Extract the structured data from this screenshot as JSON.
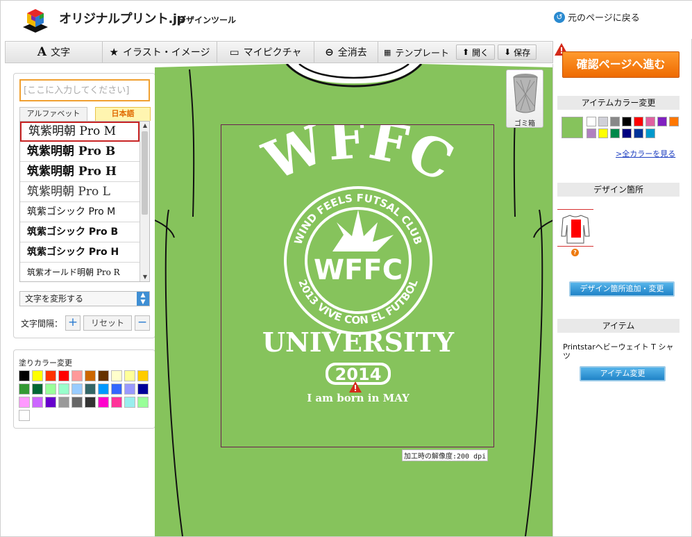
{
  "header": {
    "brand": "オリジナルプリント.jp",
    "subtitle": "デザインツール",
    "back_link": "元のページに戻る",
    "back_icon": "refresh-icon"
  },
  "toolbar": {
    "text": "文字",
    "illust": "イラスト・イメージ",
    "mypicture": "マイピクチャ",
    "clear_all": "全消去",
    "template": "テンプレート",
    "open": "開く",
    "save": "保存"
  },
  "left_panel": {
    "text_placeholder": "[ここに入力してください]",
    "tab_alphabet": "アルファベット",
    "tab_japanese": "日本語",
    "fonts": [
      "筑紫明朝 Pro M",
      "筑紫明朝 Pro B",
      "筑紫明朝 Pro H",
      "筑紫明朝 Pro L",
      "筑紫ゴシック Pro M",
      "筑紫ゴシック Pro B",
      "筑紫ゴシック Pro H",
      "筑紫オールド明朝 Pro R"
    ],
    "selected_font": "筑紫明朝 Pro M",
    "transform": "文字を変形する",
    "spacing_label": "文字間隔：",
    "spacing_reset": "リセット"
  },
  "fill_panel": {
    "title": "塗りカラー変更",
    "colors": [
      "#000000",
      "#ffff00",
      "#ff3300",
      "#ff0000",
      "#ff9999",
      "#cc6600",
      "#663300",
      "#ffffcc",
      "#ffff99",
      "#ffcc00",
      "#339933",
      "#006633",
      "#99ff99",
      "#99ffcc",
      "#99ccff",
      "#336666",
      "#0099ff",
      "#3366ff",
      "#9999ff",
      "#000099",
      "#ff99ff",
      "#cc66ff",
      "#6600cc",
      "#999999",
      "#666666",
      "#333333",
      "#ff00cc",
      "#ff3399",
      "#99eeee",
      "#99ff99",
      "#ffffff"
    ]
  },
  "canvas": {
    "shirt_color": "#86c35c",
    "trash_label": "ゴミ箱",
    "resolution": "加工時の解像度:200 dpi",
    "design": {
      "arc_title": "WFFC",
      "circle_text": "WIND FEELS FUTSAL CLUB",
      "circle_text_bottom": "2013 VIVE CON EL FUTBOL",
      "center": "WFFC",
      "university": "UNIVERSITY",
      "year": "2014",
      "tagline": "I am born in MAY"
    }
  },
  "right_panel": {
    "confirm": "確認ページへ進む",
    "item_color_title": "アイテムカラー変更",
    "item_color_selected": "#86c35c",
    "item_colors": [
      "#ffffff",
      "#d0d0d8",
      "#888888",
      "#000000",
      "#ff0000",
      "#e060a0",
      "#8020c0",
      "#ff7700",
      "#b080c0",
      "#ffff00",
      "#00884a",
      "#000080",
      "#003399",
      "#0099cc"
    ],
    "all_colors_link": ">全カラーを見る",
    "design_location_title": "デザイン箇所",
    "add_location": "デザイン箇所追加・変更",
    "item_title": "アイテム",
    "item_name": "Printstarヘビーウェイト T シャツ",
    "item_change": "アイテム変更"
  }
}
